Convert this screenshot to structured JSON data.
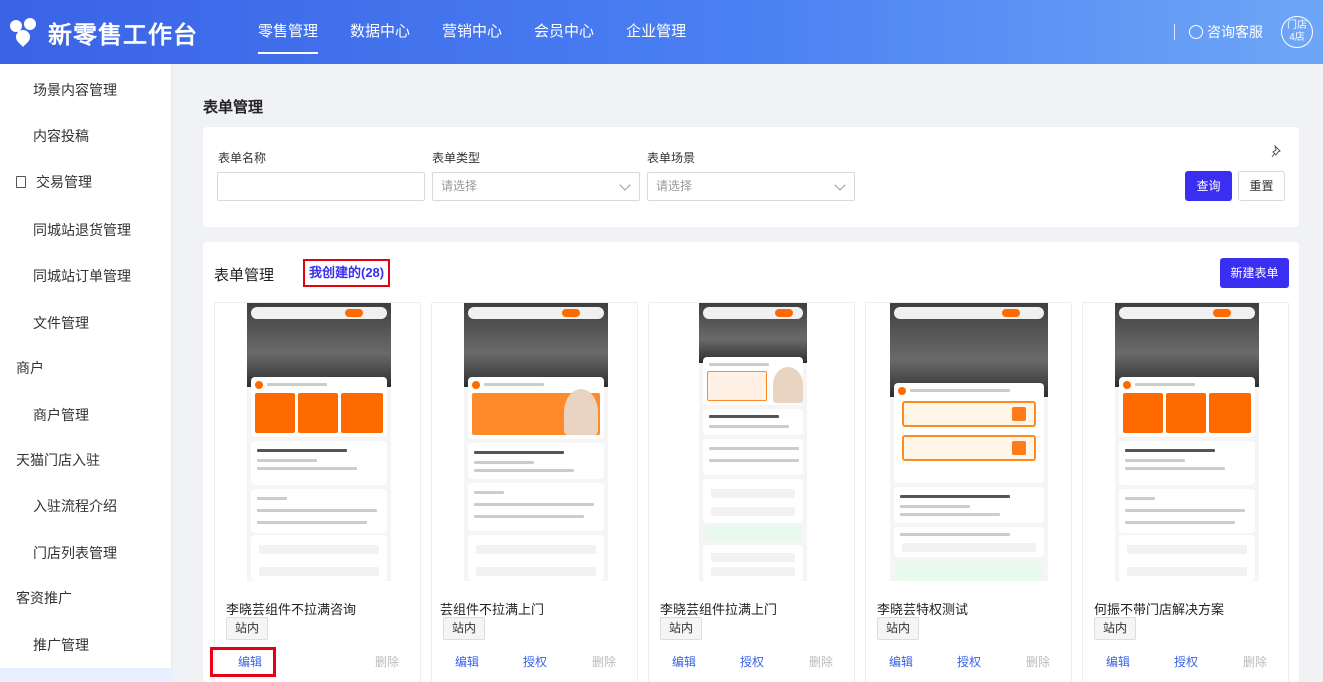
{
  "app": {
    "title": "新零售工作台",
    "nav": [
      "零售管理",
      "数据中心",
      "营销中心",
      "会员中心",
      "企业管理"
    ],
    "active_nav": "零售管理",
    "consult": "咨询客服",
    "store_badge_line1": "门店",
    "store_badge_line2": "4店"
  },
  "sidebar": {
    "items": [
      {
        "label": "场景内容管理",
        "type": "sub"
      },
      {
        "label": "内容投稿",
        "type": "sub"
      },
      {
        "label": "交易管理",
        "type": "group",
        "icon": "document-icon"
      },
      {
        "label": "同城站退货管理",
        "type": "sub"
      },
      {
        "label": "同城站订单管理",
        "type": "sub"
      },
      {
        "label": "文件管理",
        "type": "sub"
      },
      {
        "label": "商户",
        "type": "group"
      },
      {
        "label": "商户管理",
        "type": "sub"
      },
      {
        "label": "天猫门店入驻",
        "type": "group"
      },
      {
        "label": "入驻流程介绍",
        "type": "sub"
      },
      {
        "label": "门店列表管理",
        "type": "sub"
      },
      {
        "label": "客资推广",
        "type": "group"
      },
      {
        "label": "推广管理",
        "type": "sub"
      }
    ]
  },
  "page": {
    "title": "表单管理"
  },
  "filters": {
    "name_label": "表单名称",
    "name_value": "",
    "type_label": "表单类型",
    "type_placeholder": "请选择",
    "scene_label": "表单场景",
    "scene_placeholder": "请选择",
    "query_button": "查询",
    "reset_button": "重置"
  },
  "list": {
    "title": "表单管理",
    "tab_mine": "我创建的(28)",
    "new_button": "新建表单",
    "cards": [
      {
        "name": "李晓芸组件不拉满咨询",
        "tag": "站内",
        "actions": [
          "编辑",
          "删除"
        ],
        "delete_disabled": true
      },
      {
        "name": "芸组件不拉满上门",
        "tag": "站内",
        "actions": [
          "编辑",
          "授权",
          "删除"
        ],
        "delete_disabled": true
      },
      {
        "name": "李晓芸组件拉满上门",
        "tag": "站内",
        "actions": [
          "编辑",
          "授权",
          "删除"
        ],
        "delete_disabled": true
      },
      {
        "name": "李晓芸特权测试",
        "tag": "站内",
        "actions": [
          "编辑",
          "授权",
          "删除"
        ],
        "delete_disabled": true
      },
      {
        "name": "何振不带门店解决方案",
        "tag": "站内",
        "actions": [
          "编辑",
          "授权",
          "删除"
        ],
        "delete_disabled": true
      }
    ]
  },
  "colors": {
    "primary": "#3a2ff0",
    "header_gradient_start": "#3a63e6",
    "highlight_red": "#e60012",
    "link_blue": "#3a63e6"
  }
}
